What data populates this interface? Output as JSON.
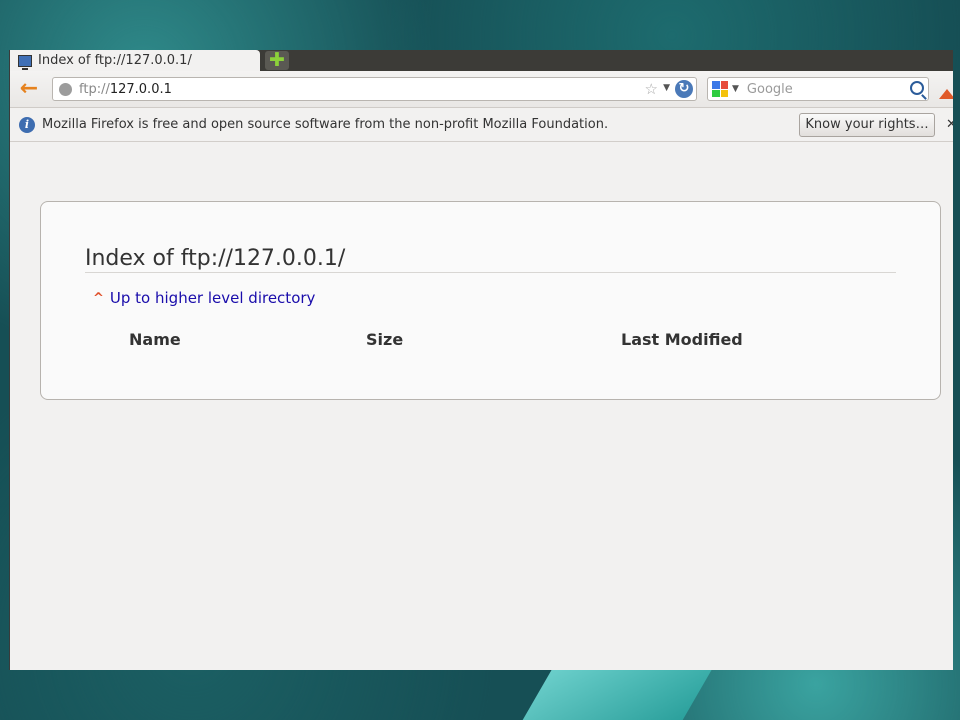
{
  "browser": {
    "tab_title": "Index of ftp://127.0.0.1/",
    "new_tab_symbol": "✚",
    "url_protocol": "ftp://",
    "url_host": "127.0.0.1",
    "search_placeholder": "Google",
    "notification_text": "Mozilla Firefox is free and open source software from the non-profit Mozilla Foundation.",
    "rights_button_label": "Know your rights…",
    "close_symbol": "✕"
  },
  "page": {
    "title": "Index of ftp://127.0.0.1/",
    "up_link": "Up to higher level directory",
    "columns": [
      "Name",
      "Size",
      "Last Modified"
    ]
  },
  "icons": {
    "back": "back-arrow-icon",
    "reload": "reload-icon",
    "bookmark": "star-icon",
    "search": "magnifier-icon",
    "info": "info-icon",
    "up": "chevron-up-icon"
  },
  "colors": {
    "accent_back": "#e6821e",
    "link": "#1a0dab",
    "up_icon": "#e0502a"
  }
}
